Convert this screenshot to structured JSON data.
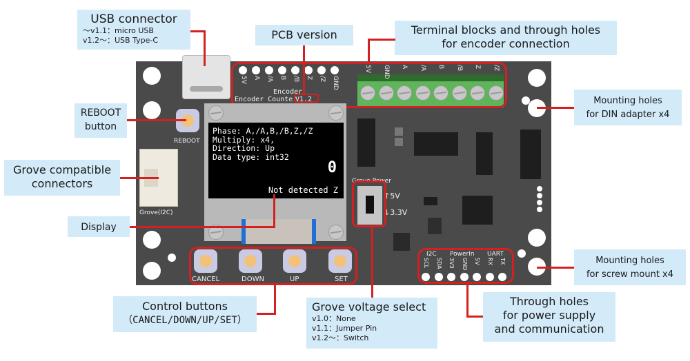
{
  "callouts": {
    "usb": {
      "title": "USB connector",
      "lines": [
        "～v1.1：micro USB",
        "v1.2～：USB Type-C"
      ]
    },
    "pcb_version": {
      "title": "PCB version"
    },
    "terminal": {
      "line1": "Terminal blocks and through holes",
      "line2": "for encoder connection"
    },
    "reboot": {
      "line1": "REBOOT",
      "line2": "button"
    },
    "grove": {
      "line1": "Grove compatible",
      "line2": "connectors"
    },
    "display": {
      "title": "Display"
    },
    "din": {
      "line1": "Mounting holes",
      "line2": "for DIN adapter x4"
    },
    "screw": {
      "line1": "Mounting holes",
      "line2": "for screw mount x4"
    },
    "control": {
      "line1": "Control buttons",
      "line2": "（CANCEL/DOWN/UP/SET）"
    },
    "grove_voltage": {
      "title": "Grove voltage select",
      "lines": [
        "v1.0：None",
        "v1.1：Jumper Pin",
        "v1.2～：Switch"
      ]
    },
    "through_holes": {
      "line1": "Through holes",
      "line2": "for power supply",
      "line3": "and communication"
    }
  },
  "board": {
    "encoder_pins": [
      "5V",
      "A",
      "/A",
      "B",
      "/B",
      "Z",
      "/Z",
      "GND"
    ],
    "encoder_label": "Encoder",
    "board_name": "Encoder Counter",
    "version": "V1.2",
    "terminal_labels": [
      "5V",
      "GND",
      "A",
      "/A",
      "B",
      "/B",
      "Z",
      "/Z"
    ],
    "reboot_label": "REBOOT",
    "grove_label": "Grove(I2C)",
    "grove_power_label": "Grove Power",
    "switch_5v": "↑5V",
    "switch_33v": "↓3.3V",
    "buttons": [
      "CANCEL",
      "DOWN",
      "UP",
      "SET"
    ],
    "header_groups": [
      "I2C",
      "PowerIn",
      "UART"
    ],
    "header_pins": [
      "SCL",
      "SDA",
      "3V3",
      "GND",
      "5V",
      "RX",
      "TX"
    ]
  },
  "screen": {
    "lines": [
      "Phase: A,/A,B,/B,Z,/Z",
      "Multiply: x4,",
      "Direction: Up",
      "Data type: int32"
    ],
    "count": "0",
    "status": "Not detected Z"
  },
  "colors": {
    "accent": "#d42020",
    "callout_bg": "#d3eaf9",
    "board": "#4a4a4a",
    "terminal_green": "#5fb55a"
  }
}
